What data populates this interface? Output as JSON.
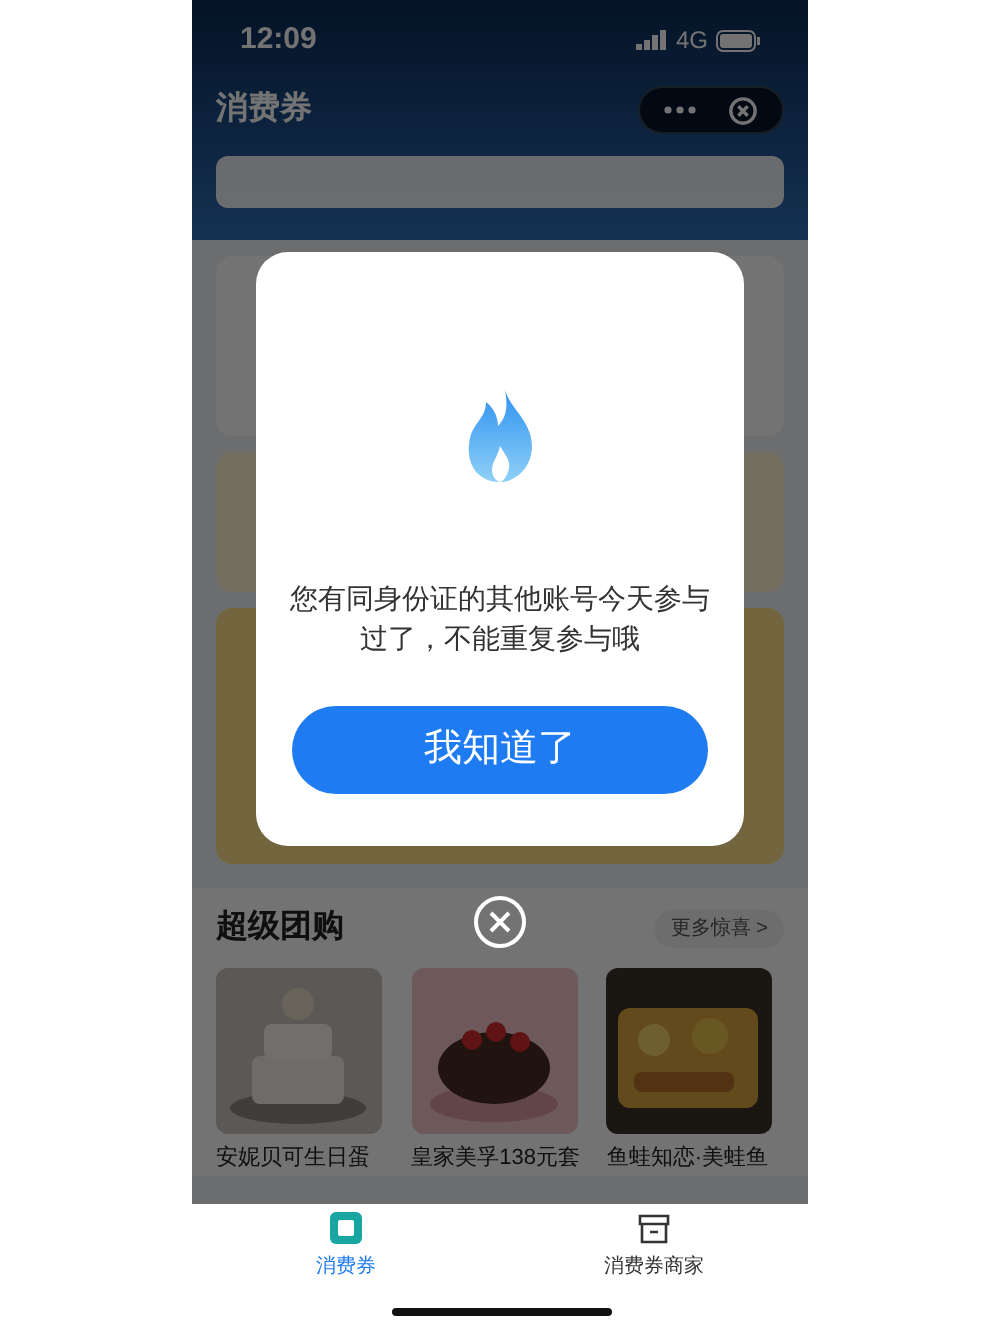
{
  "status_bar": {
    "time": "12:09",
    "network": "4G"
  },
  "nav": {
    "title": "消费券"
  },
  "section": {
    "title": "超级团购",
    "more": "更多惊喜 >"
  },
  "products": [
    {
      "title": "安妮贝可生日蛋",
      "kind": "picture"
    },
    {
      "title": "皇家美孚138元套",
      "kind": "picture"
    },
    {
      "title": "鱼蛙知恋·美蛙鱼",
      "kind": "picture"
    }
  ],
  "dialog": {
    "message": "您有同身份证的其他账号今天参与过了，不能重复参与哦",
    "button": "我知道了"
  },
  "tab_bar": [
    {
      "label": "消费券",
      "selected": true
    },
    {
      "label": "消费券商家",
      "selected": false
    }
  ]
}
